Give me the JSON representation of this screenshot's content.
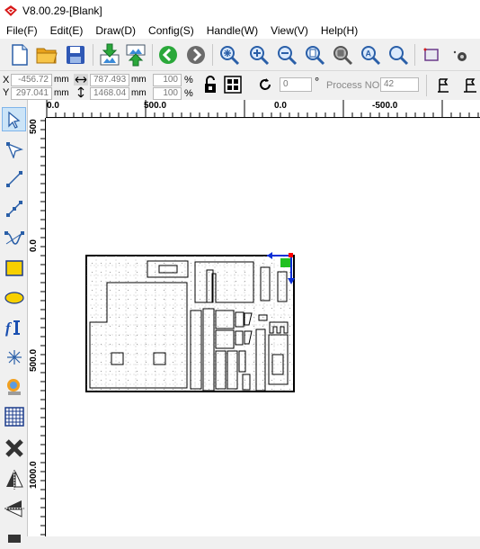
{
  "app": {
    "title": "V8.00.29-[Blank]"
  },
  "menu": [
    "File(F)",
    "Edit(E)",
    "Draw(D)",
    "Config(S)",
    "Handle(W)",
    "View(V)",
    "Help(H)"
  ],
  "toolbar": {
    "buttons": [
      "new-file-icon",
      "open-folder-icon",
      "save-icon",
      "import-icon",
      "export-icon",
      "back-icon",
      "forward-icon",
      "zoom-all-icon",
      "zoom-in-icon",
      "zoom-out-icon",
      "zoom-page-icon",
      "zoom-selection-icon",
      "zoom-object-icon",
      "zoom-1to1-icon",
      "frame-icon",
      "camera-icon"
    ]
  },
  "props": {
    "x_label": "X",
    "y_label": "Y",
    "x_value": "-456.72",
    "y_value": "297.041",
    "unit_mm": "mm",
    "width_value": "787.493",
    "height_value": "1468.04",
    "scale_x": "100",
    "scale_y": "100",
    "percent": "%",
    "rotation": "0",
    "degree": "°",
    "process_label": "Process NO:",
    "process_no": "42"
  },
  "rulers": {
    "top": [
      "0.0",
      "500.0",
      "0.0",
      "-500.0"
    ],
    "left": [
      "500",
      "0.0",
      "500.0",
      "1000.0"
    ]
  },
  "colors": {
    "selection_red": "#ff0000",
    "axis_blue": "#0a2fd6",
    "handle_green": "#20c020"
  }
}
